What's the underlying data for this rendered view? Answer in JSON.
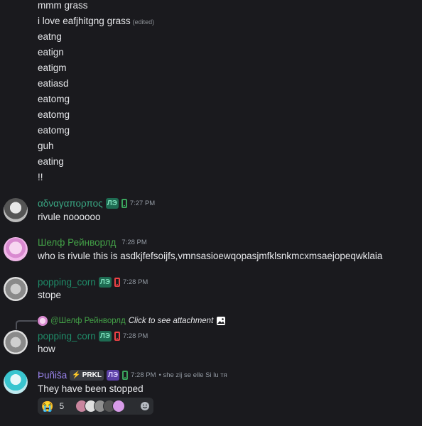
{
  "messages_top": [
    {
      "text": "mmm grass"
    },
    {
      "text": "i love eafjhitgng grass",
      "edited": "(edited)"
    },
    {
      "text": "eatng"
    },
    {
      "text": "eatign"
    },
    {
      "text": "eatigm"
    },
    {
      "text": "eatiasd"
    },
    {
      "text": "eatomg"
    },
    {
      "text": "eatomg"
    },
    {
      "text": "eatomg"
    },
    {
      "text": "guh"
    },
    {
      "text": "eating"
    },
    {
      "text": "!!"
    }
  ],
  "groups": [
    {
      "author": "αδναγαπορπος",
      "tag": "ЛЭ",
      "time": "7:27 PM",
      "text": "rivule noooooo",
      "name_color": "#3aa884",
      "phone_color": "#3ba55d"
    },
    {
      "author": "Шелф Рейнворлд",
      "time": "7:28 PM",
      "text": "who is rivule this is asdkjfefsoijfs,vmnsasioewqopasjmfklsnkmcxmsaejopeqwklaia",
      "name_color": "#43a047"
    },
    {
      "author": "popping_corn",
      "tag": "ЛЭ",
      "time": "7:28 PM",
      "text": "stope",
      "name_color": "#1f8b68",
      "phone_color": "#ed4245"
    },
    {
      "author": "popping_corn",
      "tag": "ЛЭ",
      "time": "7:28 PM",
      "text": "how",
      "name_color": "#1f8b68",
      "phone_color": "#ed4245"
    },
    {
      "author": "Þuñiša",
      "server_tag": "PRKL",
      "tag": "ЛЭ",
      "time": "7:28 PM",
      "pronouns": "• she zij se elle Si lu тя",
      "text": "They have been stopped",
      "name_color": "#9b84ee",
      "phone_color": "#3ba55d"
    }
  ],
  "reply": {
    "author": "@Шелф Рейнворлд",
    "text": "Click to see attachment",
    "image_icon": "image-icon"
  },
  "reaction": {
    "emoji": "😭",
    "count": "5",
    "add_icon": "emoji-smile-icon"
  }
}
